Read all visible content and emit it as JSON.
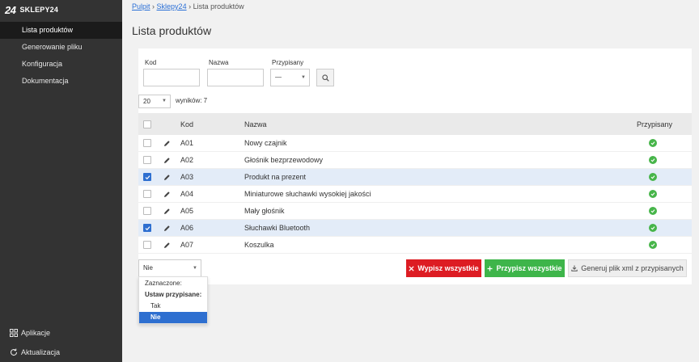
{
  "sidebar": {
    "brand_logo": "24",
    "brand_name": "SKLEPY24",
    "items": [
      {
        "label": "Lista produktów"
      },
      {
        "label": "Generowanie pliku"
      },
      {
        "label": "Konfiguracja"
      },
      {
        "label": "Dokumentacja"
      }
    ],
    "bottom": [
      {
        "label": "Aplikacje",
        "icon": "grid-icon"
      },
      {
        "label": "Aktualizacja",
        "icon": "refresh-icon"
      }
    ]
  },
  "breadcrumb": {
    "items": [
      "Pulpit",
      "Sklepy24",
      "Lista produktów"
    ],
    "separator": "›"
  },
  "page_title": "Lista produktów",
  "filters": {
    "kod_label": "Kod",
    "nazwa_label": "Nazwa",
    "przypisany_label": "Przypisany",
    "przypisany_value": "—"
  },
  "pagination": {
    "per_page": "20",
    "results_text": "wyników: 7"
  },
  "table": {
    "headers": {
      "kod": "Kod",
      "nazwa": "Nazwa",
      "przypisany": "Przypisany"
    },
    "rows": [
      {
        "kod": "A01",
        "nazwa": "Nowy czajnik",
        "checked": false,
        "assigned": true
      },
      {
        "kod": "A02",
        "nazwa": "Głośnik bezprzewodowy",
        "checked": false,
        "assigned": true
      },
      {
        "kod": "A03",
        "nazwa": "Produkt na prezent",
        "checked": true,
        "assigned": true
      },
      {
        "kod": "A04",
        "nazwa": "Miniaturowe słuchawki wysokiej jakości",
        "checked": false,
        "assigned": true
      },
      {
        "kod": "A05",
        "nazwa": "Mały głośnik",
        "checked": false,
        "assigned": true
      },
      {
        "kod": "A06",
        "nazwa": "Słuchawki Bluetooth",
        "checked": true,
        "assigned": true
      },
      {
        "kod": "A07",
        "nazwa": "Koszulka",
        "checked": false,
        "assigned": true
      }
    ]
  },
  "bulk_select": {
    "value": "Nie",
    "options": {
      "header": "Zaznaczone:",
      "group": "Ustaw przypisane:",
      "tak": "Tak",
      "nie": "Nie"
    }
  },
  "buttons": {
    "unassign_all": "Wypisz wszystkie",
    "assign_all": "Przypisz wszystkie",
    "generate_xml": "Generuj plik xml z przypisanych"
  },
  "colors": {
    "sidebar": "#333333",
    "accent": "#2e6fd0",
    "danger": "#dd1c23",
    "success": "#3eb54a"
  }
}
